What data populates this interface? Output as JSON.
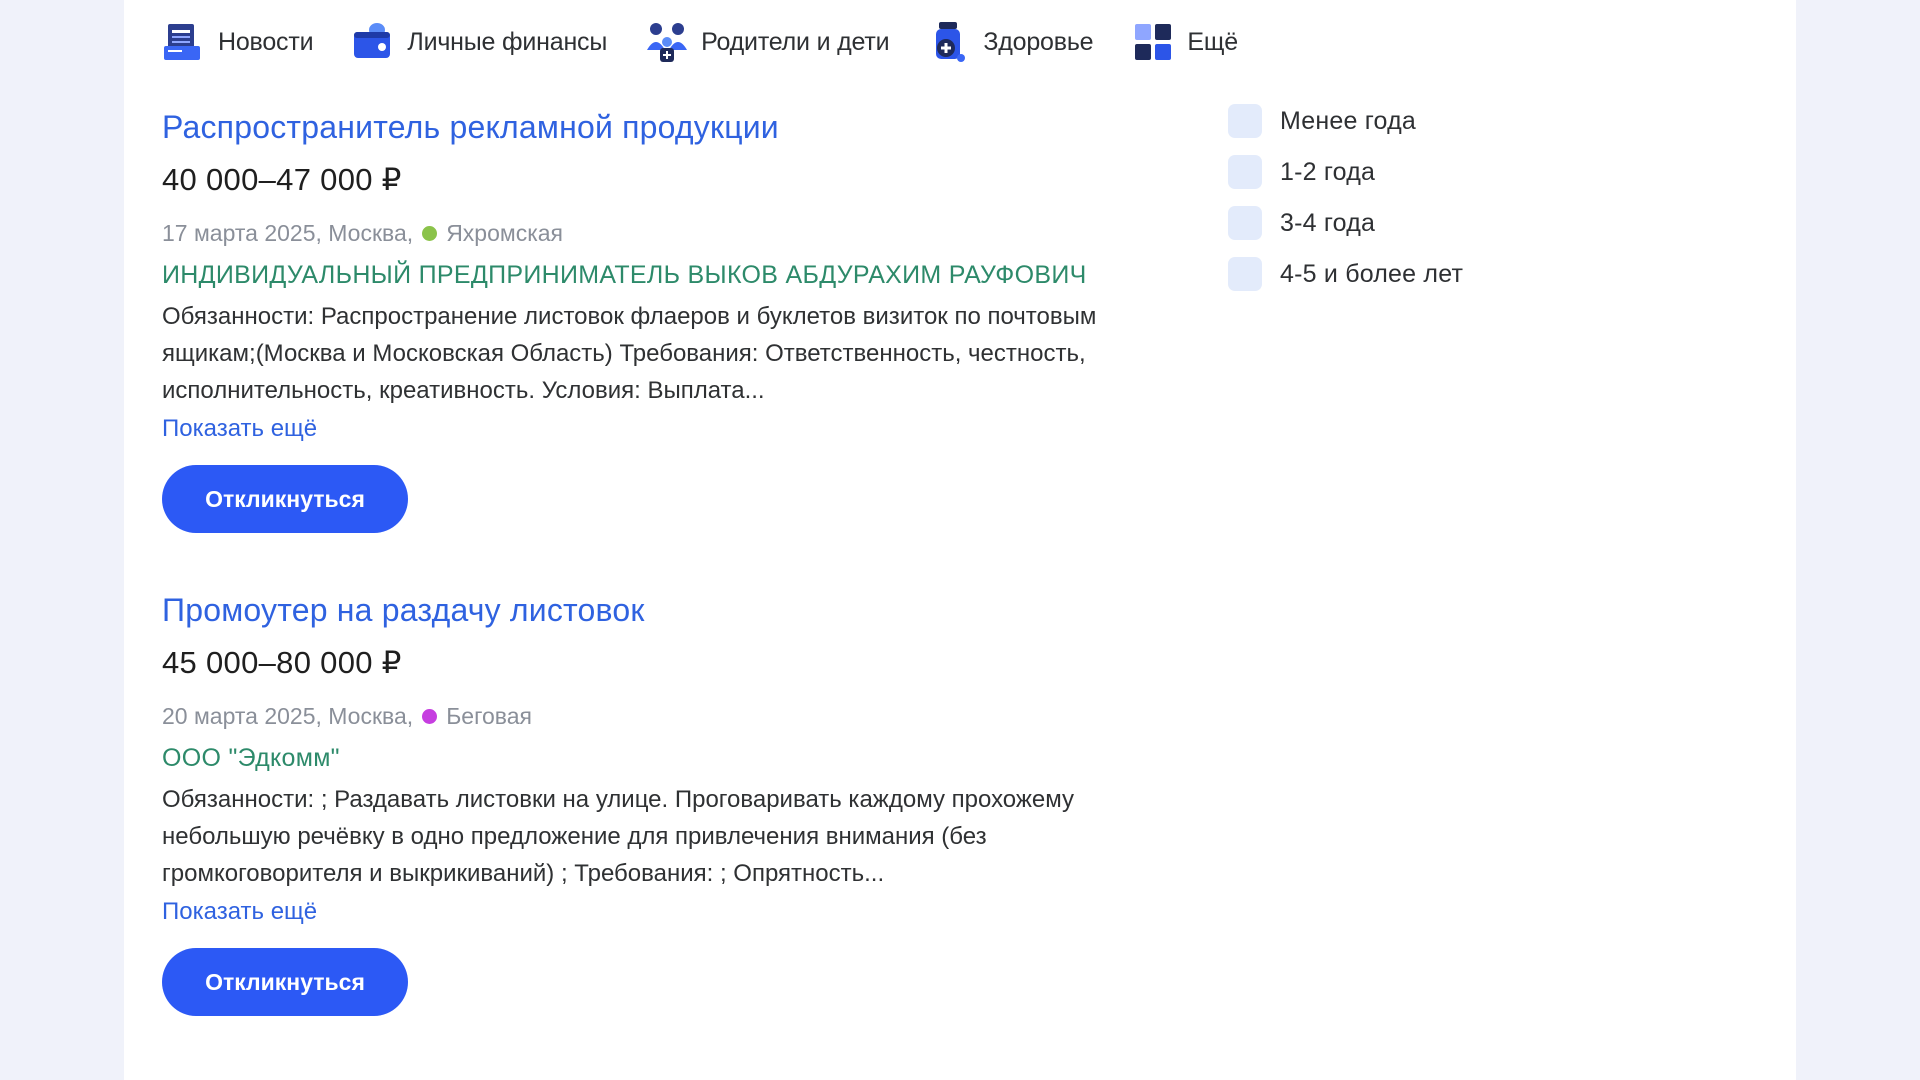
{
  "topnav": {
    "items": [
      {
        "label": "Новости",
        "icon": "news-icon"
      },
      {
        "label": "Личные финансы",
        "icon": "wallet-icon"
      },
      {
        "label": "Родители и дети",
        "icon": "family-icon"
      },
      {
        "label": "Здоровье",
        "icon": "medicine-icon"
      },
      {
        "label": "Ещё",
        "icon": "grid-icon"
      }
    ]
  },
  "vacancies": [
    {
      "title": "Распространитель рекламной продукции",
      "salary": "40 000–47 000 ₽",
      "meta": "17 марта 2025, Москва,",
      "metro": "Яхромская",
      "metro_color": "#8bc34a",
      "company": "ИНДИВИДУАЛЬНЫЙ ПРЕДПРИНИМАТЕЛЬ ВЫКОВ АБДУРАХИМ РАУФОВИЧ",
      "description": "Обязанности: Распространение листовок флаеров и буклетов визиток по почтовым ящикам;(Москва и Московская Область) Требования: Ответственность, честность, исполнительность, креативность. Условия: Выплата...",
      "more_label": "Показать ещё",
      "button_label": "Откликнуться"
    },
    {
      "title": "Промоутер на раздачу листовок",
      "salary": "45 000–80 000 ₽",
      "meta": "20 марта 2025, Москва,",
      "metro": "Беговая",
      "metro_color": "#c63ee0",
      "company": "ООО \"Эдкомм\"",
      "description": "Обязанности: ; Раздавать листовки на улице. Проговаривать каждому прохожему небольшую речёвку в одно предложение для привлечения внимания (без громкоговорителя и выкрикиваний) ; Требования: ; Опрятность...",
      "more_label": "Показать ещё",
      "button_label": "Откликнуться"
    }
  ],
  "experience_filter": {
    "options": [
      {
        "label": "Менее года",
        "checked": false
      },
      {
        "label": "1-2 года",
        "checked": false
      },
      {
        "label": "3-4 года",
        "checked": false
      },
      {
        "label": "4-5 и более лет",
        "checked": false
      }
    ]
  },
  "colors": {
    "accent": "#2c59f5",
    "link": "#2f62e0",
    "company": "#2d8a6a",
    "checkbox_bg": "#e3ebfb",
    "background": "#f0f2fa"
  }
}
